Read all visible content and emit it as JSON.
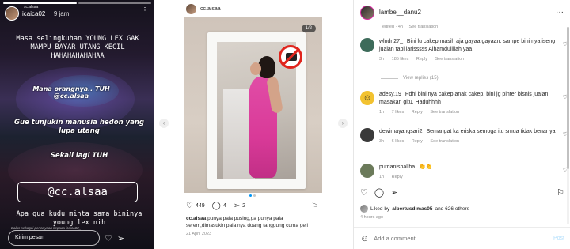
{
  "story": {
    "username": "icaica02_",
    "subtitle": "sc.alsaa",
    "time": "9 jam",
    "menu": "⋮",
    "line1": "Masa selingkuhan YOUNG LEX GAK MAMPU BAYAR UTANG KECIL HAHAHAHAHAHAA",
    "line2": "Mana orangnya.. TUH @cc.alsaa",
    "line3": "Gue tunjukin manusia hedon yang lupa utang",
    "line4": "Sekali lagi TUH",
    "tag": "@cc.alsaa",
    "line5": "Apa gua kudu minta sama bininya young lex nih",
    "reply_hint": "Balas sebagai pertanyaan kepada icaica02_",
    "reply_placeholder": "Kirim pesan",
    "heart_icon": "heart-icon",
    "send_icon": "send-icon"
  },
  "post": {
    "username": "cc.alsaa",
    "slide_indicator": "1/2",
    "likes": "449",
    "comments_count": "4",
    "shares": "2",
    "caption_user": "cc.alsaa",
    "caption_text": "punya pala pusing,ga punya pala serem,dimasukin pala nya doang tanggung cuma geli",
    "date": "21 April 2023"
  },
  "comments_panel": {
    "header_user": "lambe__danu2",
    "menu": "···",
    "topline": [
      "edited · 4h",
      "See translation"
    ],
    "comments": [
      {
        "user": "wlndri27_",
        "text": "Bini lu cakep masih aja gayaa gayaan. sampe bini nya iseng jualan tapi larisssss Alhamdulillah yaa",
        "meta": [
          "3h",
          "185 likes",
          "Reply",
          "See translation"
        ],
        "avatar_color": "#3d6b5a"
      },
      {
        "user": "adesy.19",
        "text": "Pdhl bini nya cakep anak cakep. bini jg pinter bisnis jualan masakan gitu. Haduhhhh",
        "meta": [
          "1h",
          "7 likes",
          "Reply",
          "See translation"
        ],
        "avatar_color": "#f2c230"
      },
      {
        "user": "dewimayangsari2",
        "text": "Semangat ka eriska semoga itu smua tidak benar ya",
        "meta": [
          "3h",
          "6 likes",
          "Reply",
          "See translation"
        ],
        "avatar_color": "#3a3a3a"
      },
      {
        "user": "putrianishaliha",
        "text": "👏👏",
        "meta": [
          "1h",
          "Reply"
        ],
        "avatar_color": "#6b7a5a"
      }
    ],
    "view_replies": "View replies (15)",
    "liked_by_prefix": "Liked by",
    "liked_by_user": "albertusdimas05",
    "liked_by_suffix": "and 626 others",
    "ago": "4 hours ago",
    "add_placeholder": "Add a comment...",
    "post_button": "Post"
  },
  "colors": {
    "accent": "#0095f6",
    "ring": "#d6249f",
    "dress": "#e14ca6",
    "no_sign": "#e0241c"
  }
}
